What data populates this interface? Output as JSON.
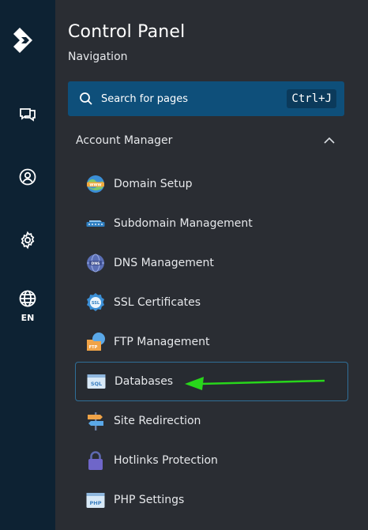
{
  "rail": {
    "items": [
      {
        "name": "chat-icon"
      },
      {
        "name": "user-icon"
      },
      {
        "name": "gear-icon"
      },
      {
        "name": "globe-icon",
        "label": "EN"
      }
    ]
  },
  "panel": {
    "title": "Control Panel",
    "subtitle": "Navigation"
  },
  "search": {
    "label": "Search for pages",
    "shortcut": "Ctrl+J"
  },
  "section": {
    "label": "Account Manager",
    "state": "expanded"
  },
  "items": [
    {
      "label": "Domain Setup",
      "icon": "www-globe-icon"
    },
    {
      "label": "Subdomain Management",
      "icon": "subdomain-icon"
    },
    {
      "label": "DNS Management",
      "icon": "dns-icon"
    },
    {
      "label": "SSL Certificates",
      "icon": "ssl-badge-icon"
    },
    {
      "label": "FTP Management",
      "icon": "ftp-folder-icon"
    },
    {
      "label": "Databases",
      "icon": "sql-database-icon",
      "active": true
    },
    {
      "label": "Site Redirection",
      "icon": "signpost-icon"
    },
    {
      "label": "Hotlinks Protection",
      "icon": "padlock-icon"
    },
    {
      "label": "PHP Settings",
      "icon": "php-icon"
    }
  ],
  "colors": {
    "rail": "#0d2233",
    "panel": "#2a2d33",
    "search": "#0e4f7a",
    "active_border": "#2f6f98",
    "annotation_arrow": "#28d61b"
  }
}
